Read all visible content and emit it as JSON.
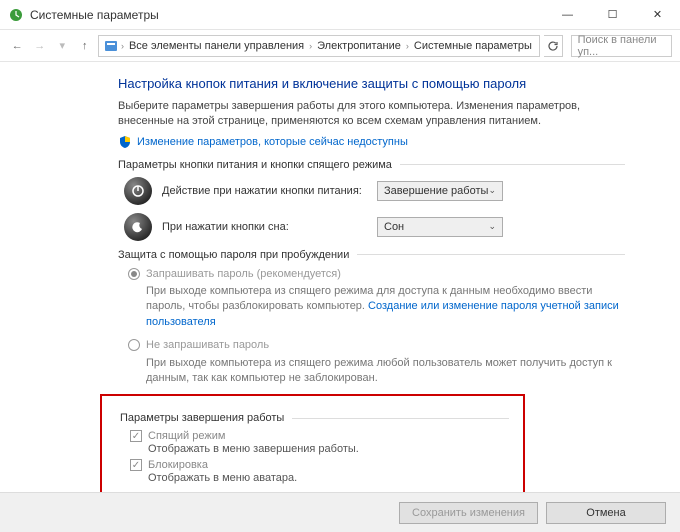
{
  "window": {
    "title": "Системные параметры"
  },
  "breadcrumb": {
    "items": [
      "Все элементы панели управления",
      "Электропитание",
      "Системные параметры"
    ]
  },
  "search": {
    "placeholder": "Поиск в панели уп..."
  },
  "heading": "Настройка кнопок питания и включение защиты с помощью пароля",
  "intro": "Выберите параметры завершения работы для этого компьютера. Изменения параметров, внесенные на этой странице, применяются ко всем схемам управления питанием.",
  "changeLink": "Изменение параметров, которые сейчас недоступны",
  "section1": {
    "title": "Параметры кнопки питания и кнопки спящего режима",
    "row1": {
      "label": "Действие при нажатии кнопки питания:",
      "value": "Завершение работы"
    },
    "row2": {
      "label": "При нажатии кнопки сна:",
      "value": "Сон"
    }
  },
  "section2": {
    "title": "Защита с помощью пароля при пробуждении",
    "opt1": {
      "label": "Запрашивать пароль (рекомендуется)",
      "desc": "При выходе компьютера из спящего режима для доступа к данным необходимо ввести пароль, чтобы разблокировать компьютер. ",
      "link": "Создание или изменение пароля учетной записи пользователя"
    },
    "opt2": {
      "label": "Не запрашивать пароль",
      "desc": "При выходе компьютера из спящего режима любой пользователь может получить доступ к данным, так как компьютер не заблокирован."
    }
  },
  "section3": {
    "title": "Параметры завершения работы",
    "chk1": {
      "label": "Спящий режим",
      "desc": "Отображать в меню завершения работы."
    },
    "chk2": {
      "label": "Блокировка",
      "desc": "Отображать в меню аватара."
    }
  },
  "footer": {
    "save": "Сохранить изменения",
    "cancel": "Отмена"
  }
}
